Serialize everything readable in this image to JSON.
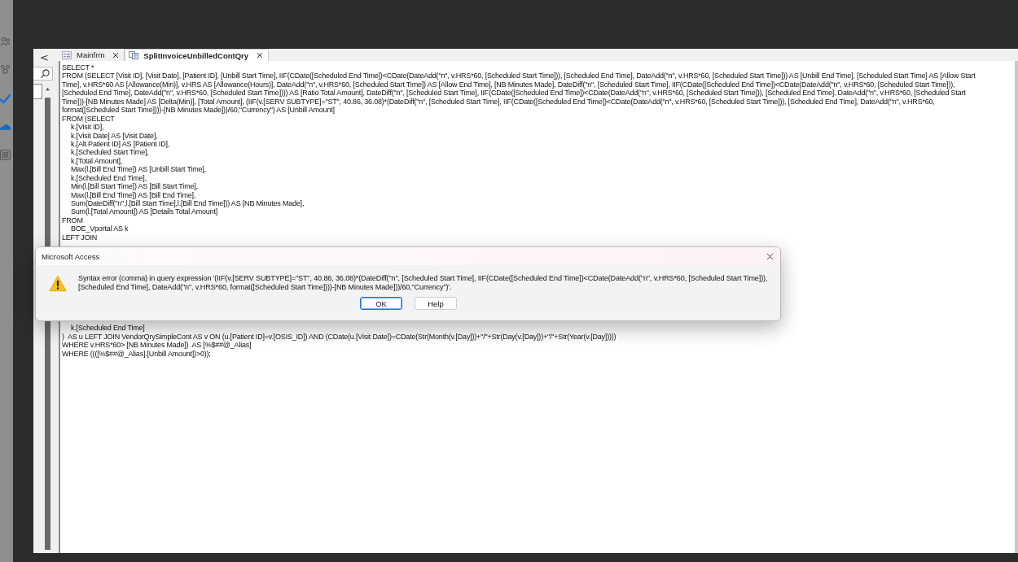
{
  "tabs": [
    {
      "label": "Mainfrm",
      "kind": "form",
      "selected": false
    },
    {
      "label": "SplitInvoiceUnbilledContQry",
      "kind": "query",
      "selected": true
    }
  ],
  "nav_pane": {
    "collapse": "<"
  },
  "sql_lines_top": [
    {
      "text": "SELECT *",
      "indented": false
    },
    {
      "text": "FROM (SELECT [Visit ID], [Visit Date], [Patient ID], [Unbill Start Time], IIF(CDate([Scheduled End Time])<CDate(DateAdd(\"n\", v.HRS*60, [Scheduled Start Time])), [Scheduled End Time], DateAdd(\"n\", v.HRS*60, [Scheduled Start Time])) AS [Unbill End Time], [Scheduled Start Time] AS [Allow Start",
      "indented": false
    },
    {
      "text": "Time], v.HRS*60 AS [Allowance(Min)], v.HRS AS [Allowance(Hours)], DateAdd(\"n\", v.HRS*60, [Scheduled Start Time]) AS [Allow End Time], [NB Minutes Made], DateDiff(\"n\", [Scheduled Start Time], IIF(CDate([Scheduled End Time])<CDate(DateAdd(\"n\", v.HRS*60, [Scheduled Start Time])),",
      "indented": false
    },
    {
      "text": "[Scheduled End Time], DateAdd(\"n\", v.HRS*60, [Scheduled Start Time]))) AS [Ratio Total Amount], DateDiff(\"n\", [Scheduled Start Time], IIF(CDate([Scheduled End Time])<CDate(DateAdd(\"n\", v.HRS*60, [Scheduled Start Time])), [Scheduled End Time], DateAdd(\"n\", v.HRS*60, [Scheduled Start",
      "indented": false
    },
    {
      "text": "Time]))-[NB Minutes Made] AS [Delta(Min)], [Total Amount], (IIF(v.[SERV SUBTYPE]=\"ST\", 40.86, 36.08)*(DateDiff(\"n\", [Scheduled Start Time], IIF(CDate([Scheduled End Time])<CDate(DateAdd(\"n\", v.HRS*60, [Scheduled Start Time])), [Scheduled End Time], DateAdd(\"n\", v.HRS*60,",
      "indented": false
    },
    {
      "text": "format([Scheduled Start Time])))-[NB Minutes Made]))/60,\"Currency\") AS [Unbill Amount]",
      "indented": false
    },
    {
      "text": "FROM (SELECT",
      "indented": false
    },
    {
      "text": "k.[Visit ID],",
      "indented": true
    },
    {
      "text": "k.[Visit Date] AS [Visit Date],",
      "indented": true
    },
    {
      "text": "k.[Alt Patient ID] AS [Patient ID],",
      "indented": true
    },
    {
      "text": "k.[Scheduled Start Time],",
      "indented": true
    },
    {
      "text": "k.[Total Amount],",
      "indented": true
    },
    {
      "text": "Max(l.[Bill End Time]) AS [Unbill Start Time],",
      "indented": true
    },
    {
      "text": "k.[Scheduled End Time],",
      "indented": true
    },
    {
      "text": "Min(l.[Bill Start Time]) AS [Bill Start Time],",
      "indented": true
    },
    {
      "text": "Max(l.[Bill End Time]) AS [Bill End Time],",
      "indented": true
    },
    {
      "text": "Sum(DateDiff(\"n\",l.[Bill Start Time],l.[Bill End Time])) AS [NB Minutes Made],",
      "indented": true
    },
    {
      "text": "Sum(l.[Total Amount]) AS [Details Total Amount]",
      "indented": true
    },
    {
      "text": "FROM",
      "indented": false
    },
    {
      "text": "BOE_Vportal AS k",
      "indented": true
    },
    {
      "text": "LEFT JOIN",
      "indented": false
    }
  ],
  "sql_lines_bottom": [
    {
      "text": "k.[Scheduled End Time]",
      "indented": true
    },
    {
      "text": ")  AS u LEFT JOIN VendorQrySimpleCont AS v ON (u.[Patient ID]=v.[OSIS_ID]) AND (CDate(u.[Visit Date])=CDate(Str(Month(v.[Day]))+\"/\"+Str(Day(v.[Day]))+\"/\"+Str(Year(v.[Day]))))",
      "indented": false
    },
    {
      "text": "WHERE v.HRS*60> [NB Minutes Made])  AS [%$##@_Alias]",
      "indented": false
    },
    {
      "text": "WHERE ((([%$##@_Alias].[Unbill Amount])>0));",
      "indented": false
    }
  ],
  "dialog": {
    "title": "Microsoft Access",
    "message": "Syntax error (comma) in query expression '(IIF(v.[SERV SUBTYPE]=\"ST\", 40.86, 36.08)*(DateDiff(\"n\", [Scheduled Start Time], IIF(CDate([Scheduled End Time])<CDate(DateAdd(\"n\", v.HRS*60, [Scheduled Start Time])), [Scheduled End Time], DateAdd(\"n\", v.HRS*60, format([Scheduled Start Time])))-[NB Minutes Made]))/60,\"Currency\")'.",
    "buttons": [
      {
        "label": "OK",
        "default": true
      },
      {
        "label": "Help",
        "default": false
      }
    ]
  }
}
